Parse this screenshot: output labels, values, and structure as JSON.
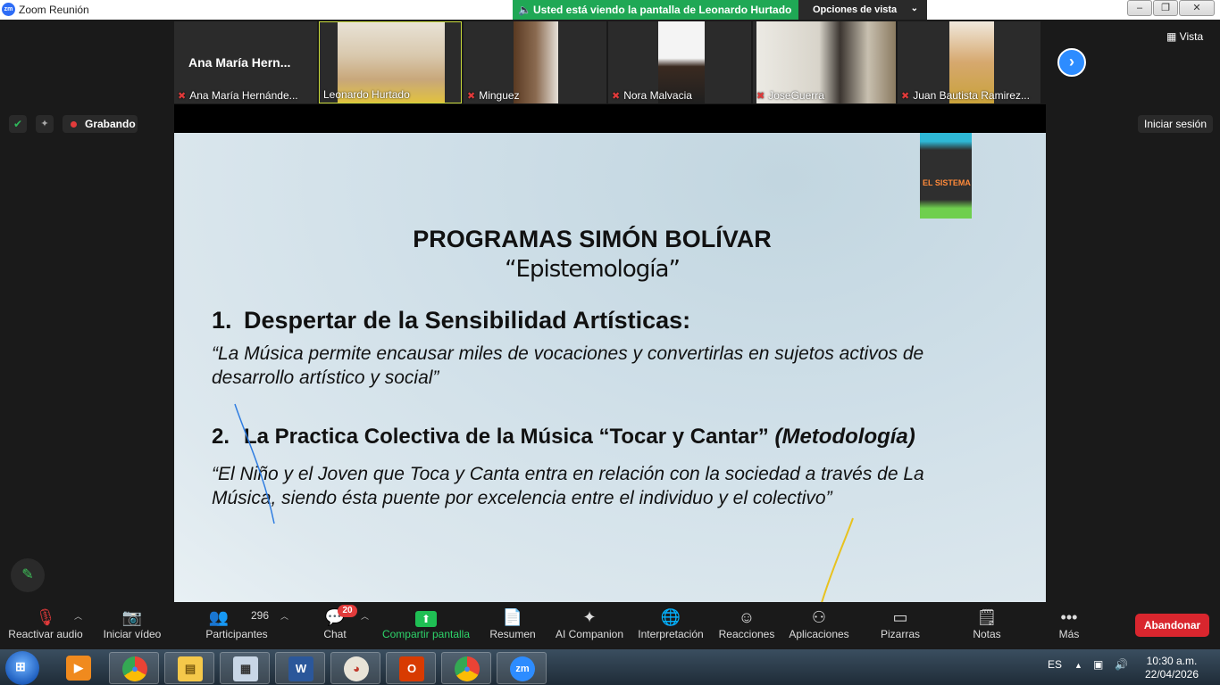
{
  "window": {
    "logo": "zm",
    "title": "Zoom Reunión",
    "controls": [
      "minimize",
      "maximize",
      "close"
    ]
  },
  "banner": {
    "text": "Usted está viendo la pantalla de Leonardo Hurtado",
    "view_options": "Opciones de vista"
  },
  "participants_strip": {
    "big_name": "Ana María Hern...",
    "tiles": [
      {
        "name": "Ana María Hernánde...",
        "muted": true
      },
      {
        "name": "Leonardo Hurtado",
        "muted": false,
        "active": true
      },
      {
        "name": "Minguez",
        "muted": true
      },
      {
        "name": "Nora Malvacia",
        "muted": true
      },
      {
        "name": "JoseGuerra",
        "muted": true
      },
      {
        "name": "Juan Bautista Ramirez...",
        "muted": true
      }
    ],
    "next_icon": "›",
    "view_label": "Vista"
  },
  "status": {
    "recording": "Grabando",
    "sign_in": "Iniciar sesión"
  },
  "slide": {
    "logo_text": "EL SISTEMA",
    "title": "PROGRAMAS SIMÓN BOLÍVAR",
    "subtitle": "“Epistemología”",
    "point1_num": "1.",
    "point1": "Despertar de la Sensibilidad Artísticas:",
    "quote1": "“La Música permite encausar miles de vocaciones y convertirlas en sujetos activos de desarrollo artístico y social”",
    "point2_num": "2.",
    "point2": "La Practica Colectiva de la Música “Tocar y Cantar”",
    "point2_em": "(Metodología)",
    "quote2": "“El Niño y el Joven que Toca y Canta entra en relación con la sociedad a través de La Música, siendo ésta puente por excelencia entre el individuo y el colectivo”"
  },
  "toolbar": {
    "audio": "Reactivar audio",
    "video": "Iniciar vídeo",
    "participants": "Participantes",
    "participants_count": "296",
    "chat": "Chat",
    "chat_badge": "20",
    "share": "Compartir pantalla",
    "summary": "Resumen",
    "ai": "AI Companion",
    "interpretation": "Interpretación",
    "reactions": "Reacciones",
    "apps": "Aplicaciones",
    "whiteboards": "Pizarras",
    "notes": "Notas",
    "more": "Más",
    "leave": "Abandonar"
  },
  "taskbar": {
    "apps": [
      "Media Player",
      "Chrome",
      "Explorador",
      "Calculadora",
      "Word",
      "Paint",
      "Office",
      "Chrome",
      "Zoom"
    ],
    "lang": "ES",
    "time": "10:30 a.m.",
    "date": "22/04/2026"
  },
  "colors": {
    "banner": "#1fa855",
    "leave": "#d9262e",
    "share": "#1fbf54",
    "accent": "#2d8cff"
  }
}
